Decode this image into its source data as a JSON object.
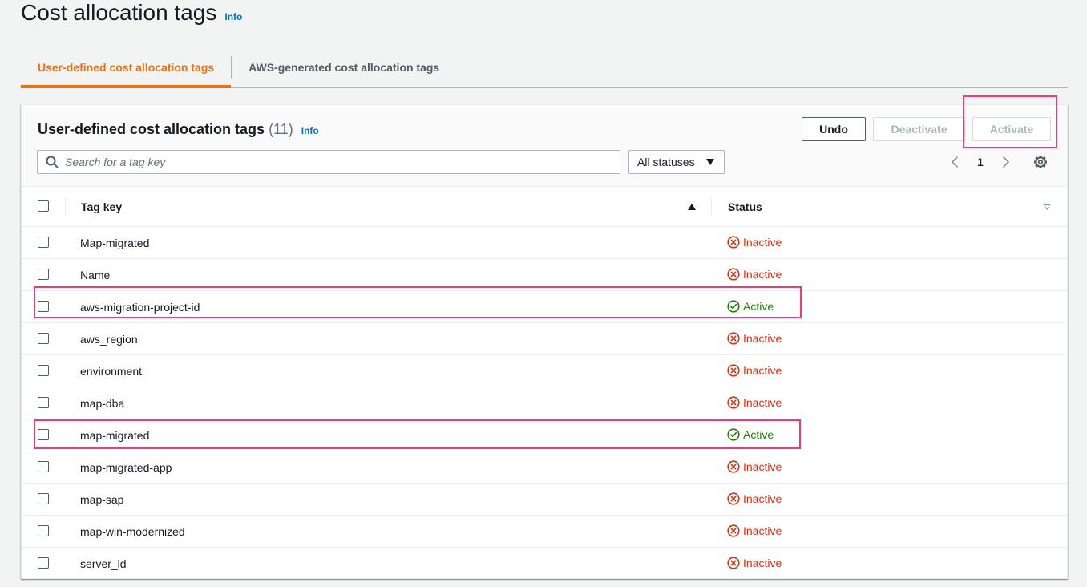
{
  "page": {
    "title": "Cost allocation tags",
    "info": "Info"
  },
  "tabs": [
    {
      "label": "User-defined cost allocation tags",
      "active": true
    },
    {
      "label": "AWS-generated cost allocation tags",
      "active": false
    }
  ],
  "panel": {
    "title": "User-defined cost allocation tags",
    "count": "(11)",
    "info": "Info",
    "buttons": {
      "undo": "Undo",
      "deactivate": "Deactivate",
      "activate": "Activate"
    },
    "search": {
      "placeholder": "Search for a tag key",
      "value": ""
    },
    "status_filter": {
      "selected": "All statuses"
    },
    "pagination": {
      "current_page": "1"
    }
  },
  "table": {
    "columns": [
      "Tag key",
      "Status"
    ],
    "rows": [
      {
        "key": "Map-migrated",
        "status": "Inactive"
      },
      {
        "key": "Name",
        "status": "Inactive"
      },
      {
        "key": "aws-migration-project-id",
        "status": "Active"
      },
      {
        "key": "aws_region",
        "status": "Inactive"
      },
      {
        "key": "environment",
        "status": "Inactive"
      },
      {
        "key": "map-dba",
        "status": "Inactive"
      },
      {
        "key": "map-migrated",
        "status": "Active"
      },
      {
        "key": "map-migrated-app",
        "status": "Inactive"
      },
      {
        "key": "map-sap",
        "status": "Inactive"
      },
      {
        "key": "map-win-modernized",
        "status": "Inactive"
      },
      {
        "key": "server_id",
        "status": "Inactive"
      }
    ]
  },
  "colors": {
    "accent": "#ec7211",
    "link": "#0073bb",
    "inactive": "#d13212",
    "active": "#1d8102",
    "highlight": "#f0387a"
  }
}
